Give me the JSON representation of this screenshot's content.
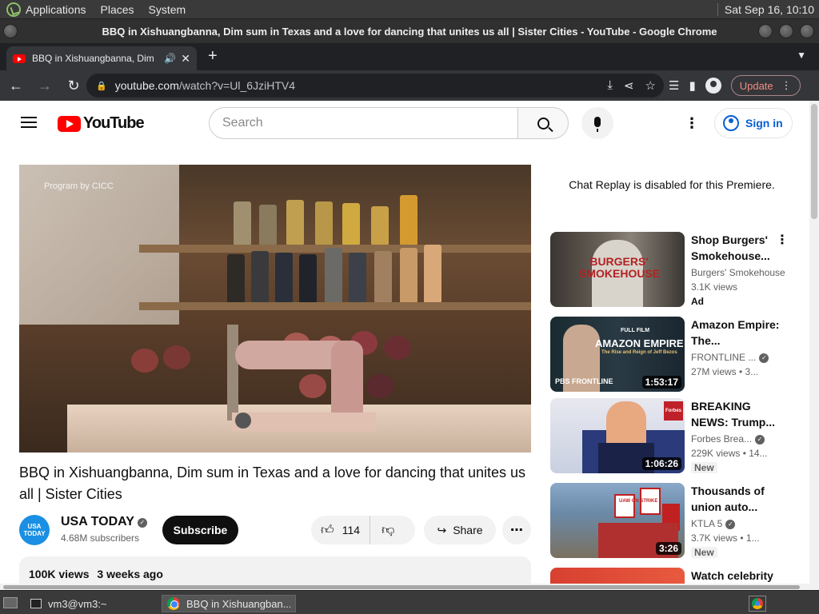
{
  "system_panel": {
    "menus": [
      "Applications",
      "Places",
      "System"
    ],
    "clock": "Sat Sep 16, 10:10"
  },
  "window": {
    "title": "BBQ in Xishuangbanna, Dim sum in Texas and a love for dancing that unites us all | Sister Cities - YouTube - Google Chrome"
  },
  "tab": {
    "title": "BBQ in Xishuangbanna, Dim",
    "audio_icon": "speaker-icon",
    "close": "✕",
    "new_tab": "+"
  },
  "toolbar": {
    "url_host": "youtube.com",
    "url_path": "/watch?v=Ul_6JziHTV4",
    "update_label": "Update"
  },
  "youtube": {
    "logo_text": "YouTube",
    "search_placeholder": "Search",
    "sign_in": "Sign in",
    "video": {
      "overlay_text": "Program by CICC",
      "title": "BBQ in Xishuangbanna, Dim sum in Texas and a love for dancing that unites us all | Sister Cities",
      "channel": "USA TODAY",
      "channel_avatar_text": "USA TODAY",
      "subscribers": "4.68M subscribers",
      "subscribe_label": "Subscribe",
      "likes": "114",
      "share_label": "Share",
      "views": "100K views",
      "age": "3 weeks ago"
    },
    "chat_replay": "Chat Replay is disabled for this Premiere.",
    "recommendations": [
      {
        "title": "Shop Burgers' Smokehouse...",
        "channel": "Burgers' Smokehouse",
        "meta": "3.1K views",
        "badge": "Ad",
        "duration": "",
        "thumb_text": "BURGERS' SMOKEHOUSE"
      },
      {
        "title": "Amazon Empire: The...",
        "channel": "FRONTLINE ...",
        "meta": "27M views • 3...",
        "badge": "",
        "duration": "1:53:17",
        "thumb_text": "AMAZON EMPIRE",
        "thumb_sub": "The Rise and Reign of Jeff Bezos",
        "thumb_tag": "FULL FILM",
        "thumb_brand": "PBS FRONTLINE"
      },
      {
        "title": "BREAKING NEWS: Trump...",
        "channel": "Forbes Brea...",
        "meta": "229K views • 14...",
        "badge": "New",
        "duration": "1:06:26",
        "thumb_brand": "Forbes"
      },
      {
        "title": "Thousands of union auto...",
        "channel": "KTLA 5",
        "meta": "3.7K views • 1...",
        "badge": "New",
        "duration": "3:26",
        "thumb_text": "UAW ON STRIKE"
      },
      {
        "title": "Watch celebrity",
        "channel": "",
        "meta": "",
        "badge": "",
        "duration": ""
      }
    ]
  },
  "taskbar": {
    "items": [
      "vm3@vm3:~",
      "BBQ in Xishuangban..."
    ]
  }
}
